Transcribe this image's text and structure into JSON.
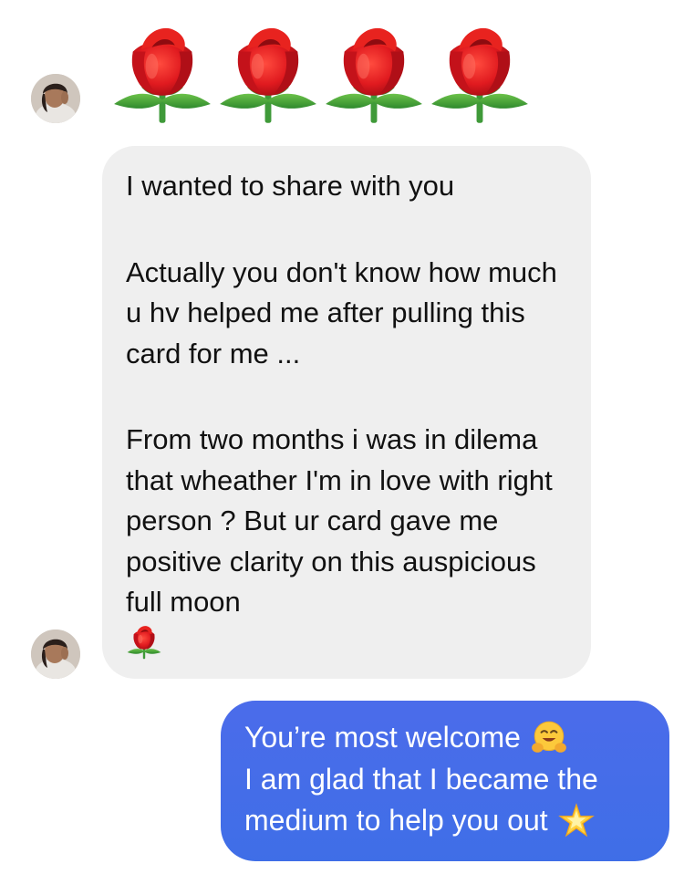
{
  "conversation": {
    "incoming": {
      "avatar_alt": "contact-avatar",
      "rose_count": 4,
      "message": {
        "line1": "I wanted to share with you",
        "para2": "Actually you don't know how much u hv helped me after pulling this card for me ...",
        "para3": "From two months i was in dilema that wheather I'm in love with right person ? But ur card gave me positive clarity on this auspicious full moon"
      }
    },
    "outgoing": {
      "line1": "You’re most welcome",
      "line2": "I am glad that I became the",
      "line3": "medium to help you out"
    }
  },
  "colors": {
    "incoming_bubble": "#efefef",
    "outgoing_bubble": "#4169e1",
    "rose_red": "#d9121b",
    "leaf_green": "#3ea33b"
  },
  "icons": {
    "rose": "rose-emoji-icon",
    "hug": "hugging-face-emoji-icon",
    "star": "glowing-star-emoji-icon"
  }
}
